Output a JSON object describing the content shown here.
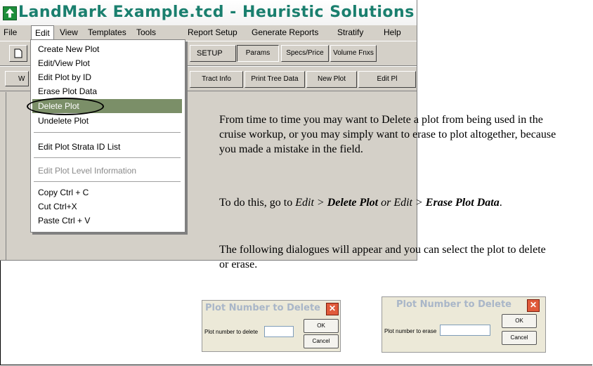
{
  "window": {
    "title": "LandMark Example.tcd - Heuristic Solutions Timber Cruis"
  },
  "menubar": [
    "File",
    "Edit",
    "View",
    "Templates",
    "Tools",
    "Report Setup",
    "Generate Reports",
    "Stratify",
    "Help"
  ],
  "toolbar1": {
    "setup_label": "SETUP",
    "buttons": [
      "Params",
      "Specs/Price",
      "Volume Fnxs"
    ]
  },
  "toolbar2": {
    "left_stub": "W",
    "buttons": [
      "Tract Info",
      "Print Tree Data",
      "New Plot",
      "Edit Pl"
    ]
  },
  "edit_menu": {
    "items": [
      "Create New Plot",
      "Edit/View Plot",
      "Edit Plot by ID",
      "Erase Plot Data",
      "Delete Plot",
      "Undelete Plot",
      "Edit Plot Strata ID List",
      "Edit Plot Level Information",
      "Copy   Ctrl + C",
      "Cut  Ctrl+X",
      "Paste  Ctrl + V"
    ],
    "selected": "Delete Plot",
    "disabled": [
      "Edit Plot Level Information"
    ]
  },
  "text": {
    "p1": "From time to time you may want to Delete a plot from being used in the cruise workup, or you may simply want to erase to plot altogether, because you made a mistake in the field.",
    "p2_a": "To do this, go to ",
    "p2_b": "Edit > ",
    "p2_c": "Delete Plot",
    "p2_d": " or Edit > ",
    "p2_e": "Erase Plot Data",
    "p2_f": ".",
    "p3": "The following dialogues will appear and you can select the plot to delete or erase."
  },
  "dialog_delete": {
    "title": "Plot Number to Delete",
    "label": "Plot number to delete",
    "value": "",
    "ok": "OK",
    "cancel": "Cancel"
  },
  "dialog_erase": {
    "title": "Plot Number to Delete",
    "label": "Plot number to erase",
    "value": "",
    "ok": "OK",
    "cancel": "Cancel"
  }
}
